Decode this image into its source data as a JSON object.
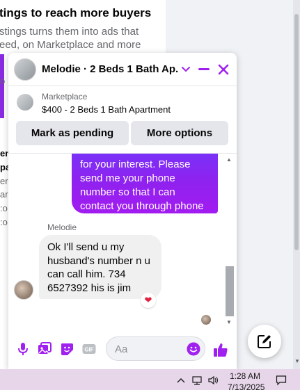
{
  "background": {
    "heading": "tings to reach more buyers",
    "body_line1": "stings turns them into ads that",
    "body_line2": "eed, on Marketplace and more",
    "frag_o": "o",
    "frag_en": "en",
    "frag_pa": "pa",
    "frag_er": "er",
    "frag_f": "f",
    "frag_ar": "ar",
    "frag_co": ":o",
    "frag_co2": ":o"
  },
  "chat": {
    "title": "Melodie · 2 Beds 1 Bath Ap...",
    "marketplace_label": "Marketplace",
    "listing": "$400 - 2 Beds 1 Bath Apartment",
    "mark_pending_label": "Mark as pending",
    "more_options_label": "More options",
    "outgoing_message": "for your interest. Please\nsend me your phone\nnumber so that I can\ncontact you through phone",
    "sender_name": "Melodie",
    "incoming_message": "Ok I'll send u my\nhusband's number n u\ncan call him. 734\n6527392 his is jim",
    "reaction": "❤",
    "input_placeholder": "Aa",
    "input_value": "",
    "accent_color": "#a020f0",
    "bubble_gradient": [
      "#6a3cff",
      "#a21cf0"
    ]
  },
  "taskbar": {
    "time": "1:28 AM",
    "date": "7/13/2025"
  }
}
